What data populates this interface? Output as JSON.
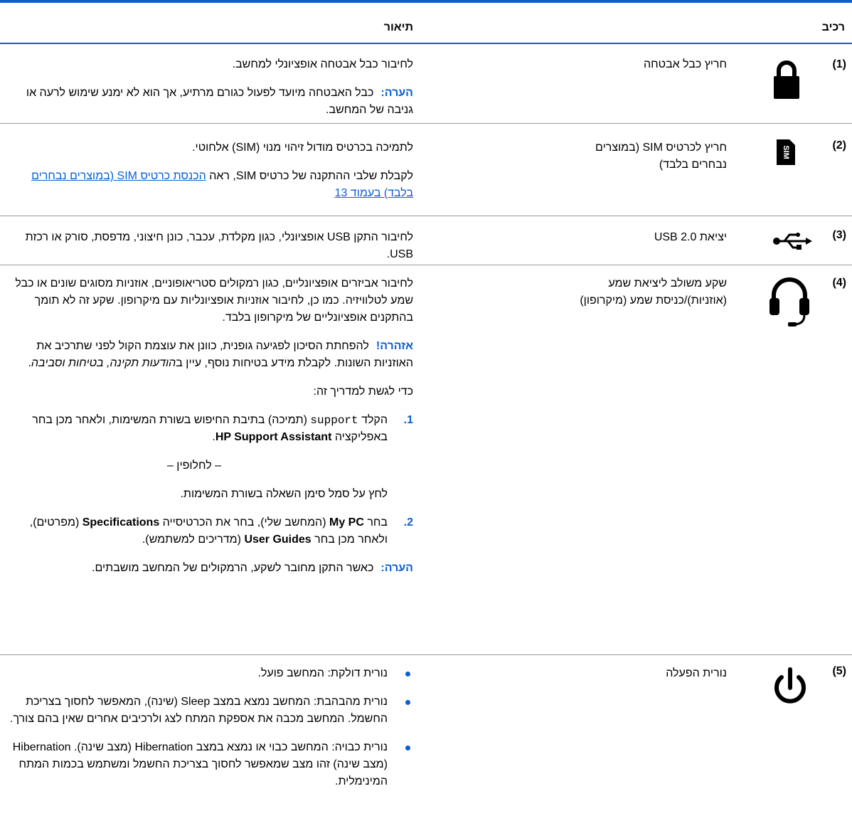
{
  "header": {
    "component": "רכיב",
    "description": "תיאור"
  },
  "rows": [
    {
      "number": "(1)",
      "icon": "lock-icon",
      "name": "חריץ כבל אבטחה",
      "desc1": "לחיבור כבל אבטחה אופציונלי למחשב.",
      "note_label": "הערה:",
      "note_text": "כבל האבטחה מיועד לפעול כגורם מרתיע, אך הוא לא ימנע שימוש לרעה או גניבה של המחשב."
    },
    {
      "number": "(2)",
      "icon": "sim-card-icon",
      "name": "חריץ לכרטיס SIM (במוצרים נבחרים בלבד)",
      "desc1": "לתמיכה בכרטיס מודול זיהוי מנוי (SIM) אלחוטי.",
      "desc2_prefix": "לקבלת שלבי ההתקנה של כרטיס SIM, ראה",
      "desc2_link": "הכנסת כרטיס SIM (במוצרים נבחרים בלבד) בעמוד 13",
      "sim_text": "SIM"
    },
    {
      "number": "(3)",
      "icon": "usb-icon",
      "name": "יציאת USB 2.0",
      "desc1": "לחיבור התקן USB אופציונלי, כגון מקלדת, עכבר, כונן חיצוני, מדפסת, סורק או רכזת USB."
    },
    {
      "number": "(4)",
      "icon": "headset-icon",
      "name": "שקע משולב ליציאת שמע (אוזניות)/כניסת שמע (מיקרופון)",
      "desc1": "לחיבור אביזרים אופציונליים, כגון רמקולים סטריאופוניים, אוזניות מסוגים שונים או כבל שמע לטלוויזיה. כמו כן, לחיבור אוזניות אופציונליות עם מיקרופון. שקע זה לא תומך בהתקנים אופציונליים של מיקרופון בלבד.",
      "warning_label": "אזהרה!",
      "warning_text": "להפחתת הסיכון לפגיעה גופנית, כוונן את עוצמת הקול לפני שתרכיב את האוזניות השונות. לקבלת מידע בטיחות נוסף, עיין ב",
      "warning_italic": "הודעות תקינה, בטיחות וסביבה",
      "guide_intro": "כדי לגשת למדריך זה:",
      "step1_num": "1.",
      "step1_a": "הקלד",
      "step1_code": "support",
      "step1_b": "(תמיכה) בתיבת החיפוש בשורת המשימות, ולאחר מכן בחר באפליקציה",
      "step1_app": "HP Support Assistant",
      "alt_sep": "– לחלופין –",
      "alt_text": "לחץ על סמל סימן השאלה בשורת המשימות.",
      "step2_num": "2.",
      "step2_a": "בחר",
      "step2_mypc": "My PC",
      "step2_b": "(המחשב שלי), בחר את הכרטיסייה",
      "step2_spec": "Specifications",
      "step2_c": "(מפרטים), ולאחר מכן בחר",
      "step2_ug": "User Guides",
      "step2_d": "(מדריכים למשתמש).",
      "note_label": "הערה:",
      "note_text": "כאשר התקן מחובר לשקע, הרמקולים של המחשב מושבתים."
    },
    {
      "number": "(5)",
      "icon": "power-icon",
      "name": "נורית הפעלה",
      "bullets": [
        "נורית דולקת: המחשב פועל.",
        "נורית מהבהבת: המחשב נמצא במצב Sleep (שינה), המאפשר לחסוך בצריכת החשמל. המחשב מכבה את אספקת המתח לצג ולרכיבים אחרים שאין בהם צורך.",
        "נורית כבויה: המחשב כבוי או נמצא במצב Hibernation (מצב שינה). Hibernation (מצב שינה) זהו מצב שמאפשר לחסוך בצריכת החשמל ומשתמש בכמות המתח המינימלית."
      ]
    }
  ]
}
